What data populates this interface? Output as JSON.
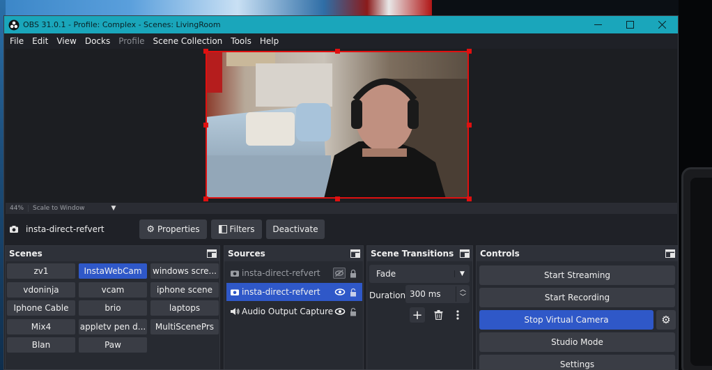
{
  "window": {
    "title": "OBS 31.0.1 - Profile: Complex - Scenes: LivingRoom",
    "accent_color": "#1aa6bb"
  },
  "menu": [
    "File",
    "Edit",
    "View",
    "Docks",
    "Profile",
    "Scene Collection",
    "Tools",
    "Help"
  ],
  "preview": {
    "zoom": "44%",
    "scale_mode": "Scale to Window",
    "selection_color": "#e01010"
  },
  "source_toolbar": {
    "source_name": "insta-direct-refvert",
    "properties": "Properties",
    "filters": "Filters",
    "deactivate": "Deactivate"
  },
  "scenes": {
    "title": "Scenes",
    "items": [
      "zv1",
      "InstaWebCam",
      "windows scre...",
      "vdoninja",
      "vcam",
      "iphone scene",
      "Iphone Cable",
      "brio",
      "laptops",
      "Mix4",
      "appletv pen d...",
      "MultiScenePrs",
      "Blan",
      "Paw"
    ],
    "active": "InstaWebCam"
  },
  "sources": {
    "title": "Sources",
    "items": [
      {
        "name": "insta-direct-refvert",
        "icon": "camera-icon",
        "visible": false,
        "state": "dim"
      },
      {
        "name": "insta-direct-refvert",
        "icon": "camera-icon",
        "visible": true,
        "state": "active"
      },
      {
        "name": "Audio Output Capture",
        "icon": "speaker-icon",
        "visible": true,
        "state": "normal"
      }
    ]
  },
  "transitions": {
    "title": "Scene Transitions",
    "selected": "Fade",
    "duration_label": "Duration",
    "duration_value": "300 ms"
  },
  "controls": {
    "title": "Controls",
    "buttons": [
      "Start Streaming",
      "Start Recording",
      "Stop Virtual Camera",
      "Studio Mode",
      "Settings"
    ],
    "active_button": "Stop Virtual Camera"
  }
}
